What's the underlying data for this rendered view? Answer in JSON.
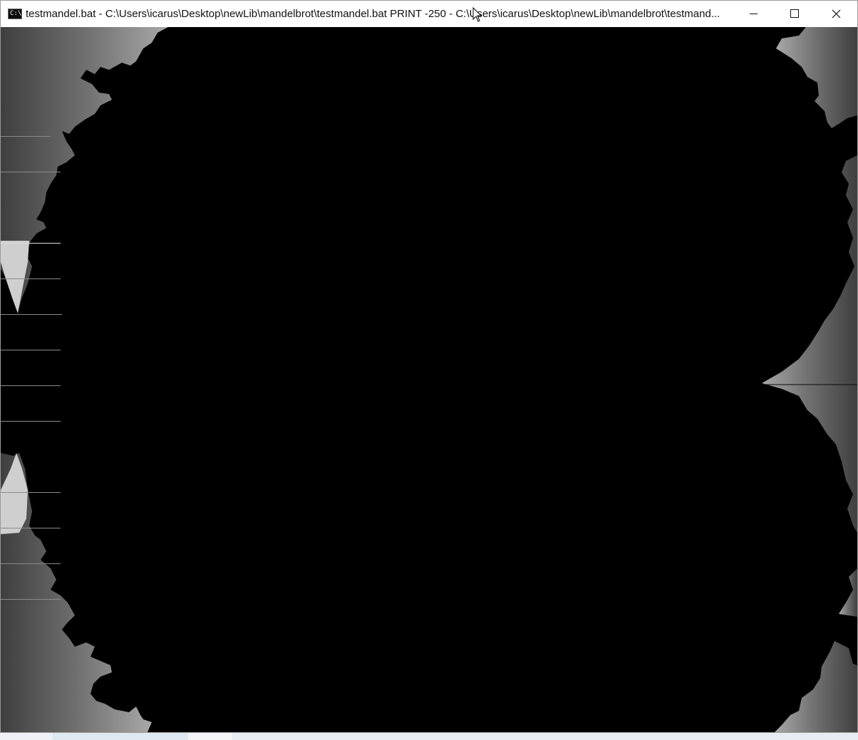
{
  "window": {
    "title": "testmandel.bat - C:\\Users\\icarus\\Desktop\\newLib\\mandelbrot\\testmandel.bat   PRINT -250 - C:\\Users\\icarus\\Desktop\\newLib\\mandelbrot\\testmand...",
    "icon": "cmd-console-icon",
    "icon_text": "C:\\."
  },
  "controls": {
    "minimize": "minimize-icon",
    "maximize": "maximize-icon",
    "close": "close-icon"
  },
  "canvas": {
    "content": "mandelbrot-fractal-render",
    "background": "#000000",
    "fractal_colors": [
      "#3a3a3a",
      "#6a6a6a",
      "#9a9a9a",
      "#cfcfcf"
    ]
  }
}
